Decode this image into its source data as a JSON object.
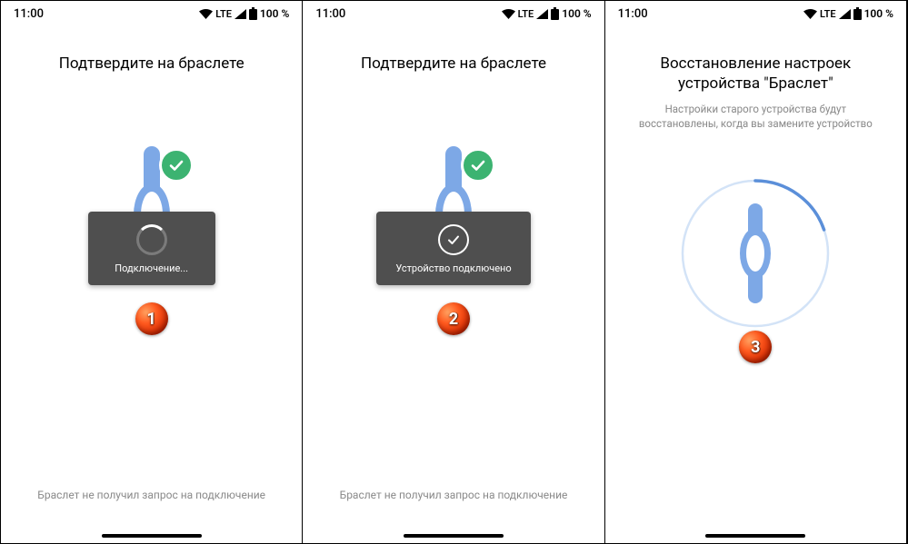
{
  "status": {
    "time": "11:00",
    "network": "LTE",
    "battery": "100 %"
  },
  "panels": [
    {
      "title": "Подтвердите на браслете",
      "toast": "Подключение...",
      "footer": "Браслет не получил запрос на подключение",
      "badge": "1"
    },
    {
      "title": "Подтвердите на браслете",
      "toast": "Устройство подключено",
      "footer": "Браслет не получил запрос на подключение",
      "badge": "2"
    },
    {
      "title": "Восстановление настроек устройства \"Браслет\"",
      "subtitle": "Настройки старого устройства будут восстановлены, когда вы замените устройство",
      "badge": "3"
    }
  ]
}
